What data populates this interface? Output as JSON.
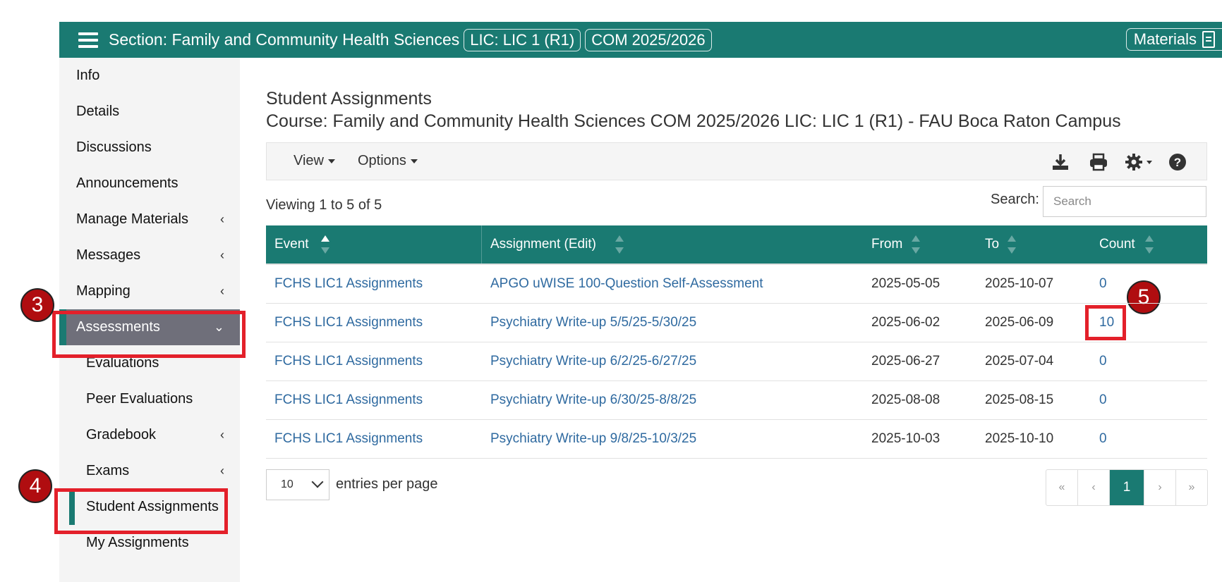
{
  "topbar": {
    "section_title": "Section: Family and Community Health Sciences",
    "pill_lic": "LIC: LIC 1 (R1)",
    "pill_com": "COM 2025/2026",
    "materials_label": "Materials"
  },
  "sidebar": {
    "items": [
      {
        "label": "Info"
      },
      {
        "label": "Details"
      },
      {
        "label": "Discussions"
      },
      {
        "label": "Announcements"
      },
      {
        "label": "Manage Materials",
        "chev": "‹"
      },
      {
        "label": "Messages",
        "chev": "‹"
      },
      {
        "label": "Mapping",
        "chev": "‹"
      },
      {
        "label": "Assessments",
        "chev": "⌄"
      },
      {
        "label": "Evaluations"
      },
      {
        "label": "Peer Evaluations"
      },
      {
        "label": "Gradebook",
        "chev": "‹"
      },
      {
        "label": "Exams",
        "chev": "‹"
      },
      {
        "label": "Student Assignments"
      },
      {
        "label": "My Assignments"
      }
    ]
  },
  "annotations": {
    "three": "3",
    "four": "4",
    "five": "5"
  },
  "main": {
    "title": "Student Assignments",
    "subtitle": "Course: Family and Community Health Sciences COM 2025/2026 LIC: LIC 1 (R1) - FAU Boca Raton Campus",
    "toolbar": {
      "view_label": "View",
      "options_label": "Options"
    },
    "viewing_text": "Viewing 1 to 5 of 5",
    "search_label": "Search:",
    "search_placeholder": "Search",
    "table": {
      "headers": [
        "Event",
        "Assignment (Edit)",
        "From",
        "To",
        "Count"
      ],
      "rows": [
        [
          "FCHS LIC1 Assignments",
          "APGO uWISE 100-Question Self-Assessment",
          "2025-05-05",
          "2025-10-07",
          "0"
        ],
        [
          "FCHS LIC1 Assignments",
          "Psychiatry Write-up 5/5/25-5/30/25",
          "2025-06-02",
          "2025-06-09",
          "10"
        ],
        [
          "FCHS LIC1 Assignments",
          "Psychiatry Write-up 6/2/25-6/27/25",
          "2025-06-27",
          "2025-07-04",
          "0"
        ],
        [
          "FCHS LIC1 Assignments",
          "Psychiatry Write-up 6/30/25-8/8/25",
          "2025-08-08",
          "2025-08-15",
          "0"
        ],
        [
          "FCHS LIC1 Assignments",
          "Psychiatry Write-up 9/8/25-10/3/25",
          "2025-10-03",
          "2025-10-10",
          "0"
        ]
      ]
    },
    "per_page_value": "10",
    "per_page_label": "entries per page",
    "pager": {
      "first": "«",
      "prev": "‹",
      "current": "1",
      "next": "›",
      "last": "»"
    }
  },
  "colors": {
    "brand": "#1a7a72",
    "link": "#2f6aa0",
    "callout": "#e3202a",
    "active_nav": "#6f6f7a"
  }
}
